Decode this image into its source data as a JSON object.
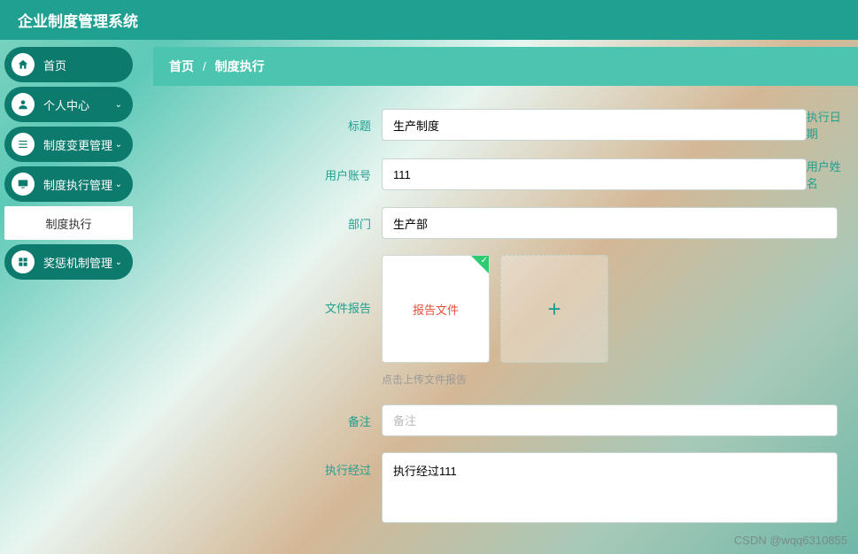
{
  "header": {
    "title": "企业制度管理系统"
  },
  "sidebar": {
    "items": [
      {
        "label": "首页",
        "icon": "home",
        "expandable": false
      },
      {
        "label": "个人中心",
        "icon": "user",
        "expandable": true
      },
      {
        "label": "制度变更管理",
        "icon": "list",
        "expandable": true
      },
      {
        "label": "制度执行管理",
        "icon": "monitor",
        "expandable": true
      },
      {
        "label": "奖惩机制管理",
        "icon": "grid",
        "expandable": true
      }
    ],
    "submenu": {
      "label": "制度执行"
    }
  },
  "breadcrumb": {
    "home": "首页",
    "sep": "/",
    "current": "制度执行"
  },
  "form": {
    "title": {
      "label": "标题",
      "value": "生产制度"
    },
    "exec_date": {
      "label": "执行日期"
    },
    "user_account": {
      "label": "用户账号",
      "value": "111"
    },
    "user_name": {
      "label": "用户姓名"
    },
    "department": {
      "label": "部门",
      "value": "生产部"
    },
    "file_report": {
      "label": "文件报告",
      "file_text": "报告文件"
    },
    "upload_hint": "点击上传文件报告",
    "remark": {
      "label": "备注",
      "placeholder": "备注",
      "value": ""
    },
    "exec_process": {
      "label": "执行经过",
      "value": "执行经过111"
    }
  },
  "watermark": "CSDN @wqq6310855"
}
